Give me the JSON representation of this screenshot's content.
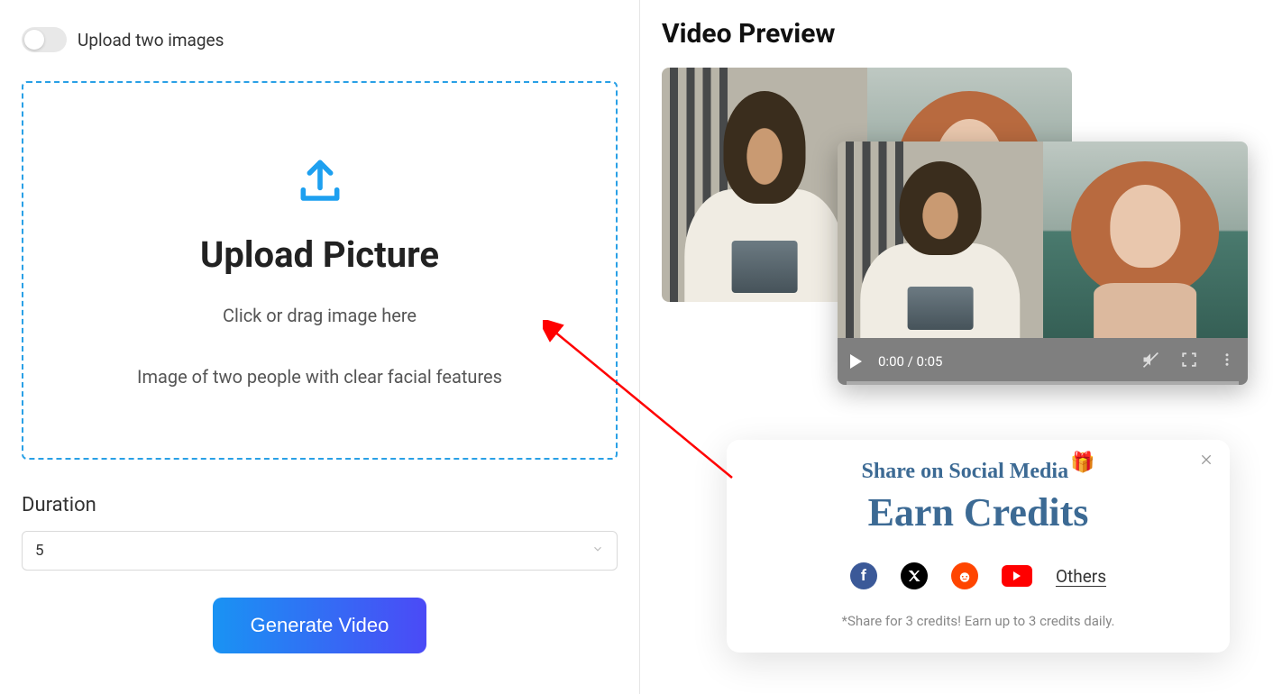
{
  "left": {
    "toggle_label": "Upload two images",
    "dropzone": {
      "title": "Upload Picture",
      "sub1": "Click or drag image here",
      "sub2": "Image of two people with clear facial features"
    },
    "duration_label": "Duration",
    "duration_value": "5",
    "generate_label": "Generate Video"
  },
  "right": {
    "preview_title": "Video Preview",
    "video": {
      "time_display": "0:00 / 0:05"
    }
  },
  "share": {
    "line1": "Share on Social Media",
    "line2": "Earn Credits",
    "others_label": "Others",
    "note": "*Share for 3 credits! Earn up to 3 credits daily."
  }
}
